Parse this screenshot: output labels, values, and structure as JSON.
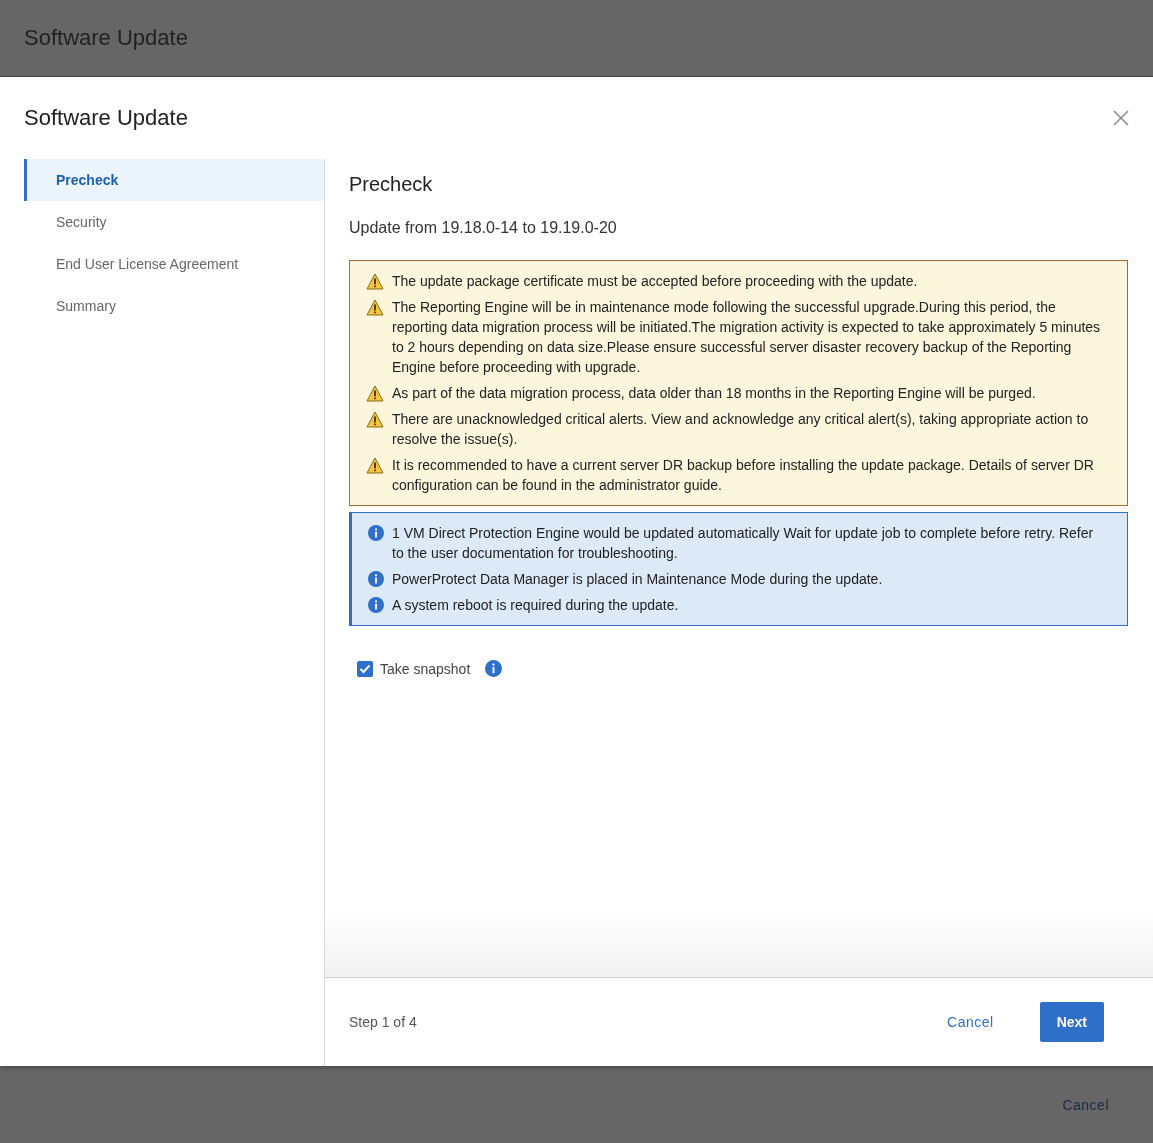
{
  "page": {
    "title": "Software Update",
    "cancel_label": "Cancel"
  },
  "dialog": {
    "title": "Software Update",
    "steps": [
      {
        "label": "Precheck",
        "selected": true
      },
      {
        "label": "Security",
        "selected": false
      },
      {
        "label": "End User License Agreement",
        "selected": false
      },
      {
        "label": "Summary",
        "selected": false
      }
    ],
    "heading": "Precheck",
    "subtitle": "Update from 19.18.0-14 to 19.19.0-20",
    "notices": [
      {
        "kind": "warning",
        "messages": [
          "The update package certificate must be accepted before proceeding with the update.",
          "The Reporting Engine will be in maintenance mode following the successful upgrade.During this period, the reporting data migration process will be initiated.The migration activity is expected to take approximately 5 minutes to 2 hours depending on data size.Please ensure successful server disaster recovery backup of the Reporting Engine before proceeding with upgrade.",
          "As part of the data migration process, data older than 18 months in the Reporting Engine will be purged.",
          "There are unacknowledged critical alerts. View and acknowledge any critical alert(s), taking appropriate action to resolve the issue(s).",
          "It is recommended to have a current server DR backup before installing the update package. Details of server DR configuration can be found in the administrator guide."
        ]
      },
      {
        "kind": "info",
        "messages": [
          "1 VM Direct Protection Engine would be updated automatically Wait for update job to complete before retry. Refer to the user documentation for troubleshooting.",
          "PowerProtect Data Manager is placed in Maintenance Mode during the update.",
          "A system reboot is required during the update."
        ]
      }
    ],
    "snapshot": {
      "label": "Take snapshot",
      "checked": true
    },
    "step_text": "Step 1 of 4",
    "cancel_label": "Cancel",
    "next_label": "Next"
  }
}
